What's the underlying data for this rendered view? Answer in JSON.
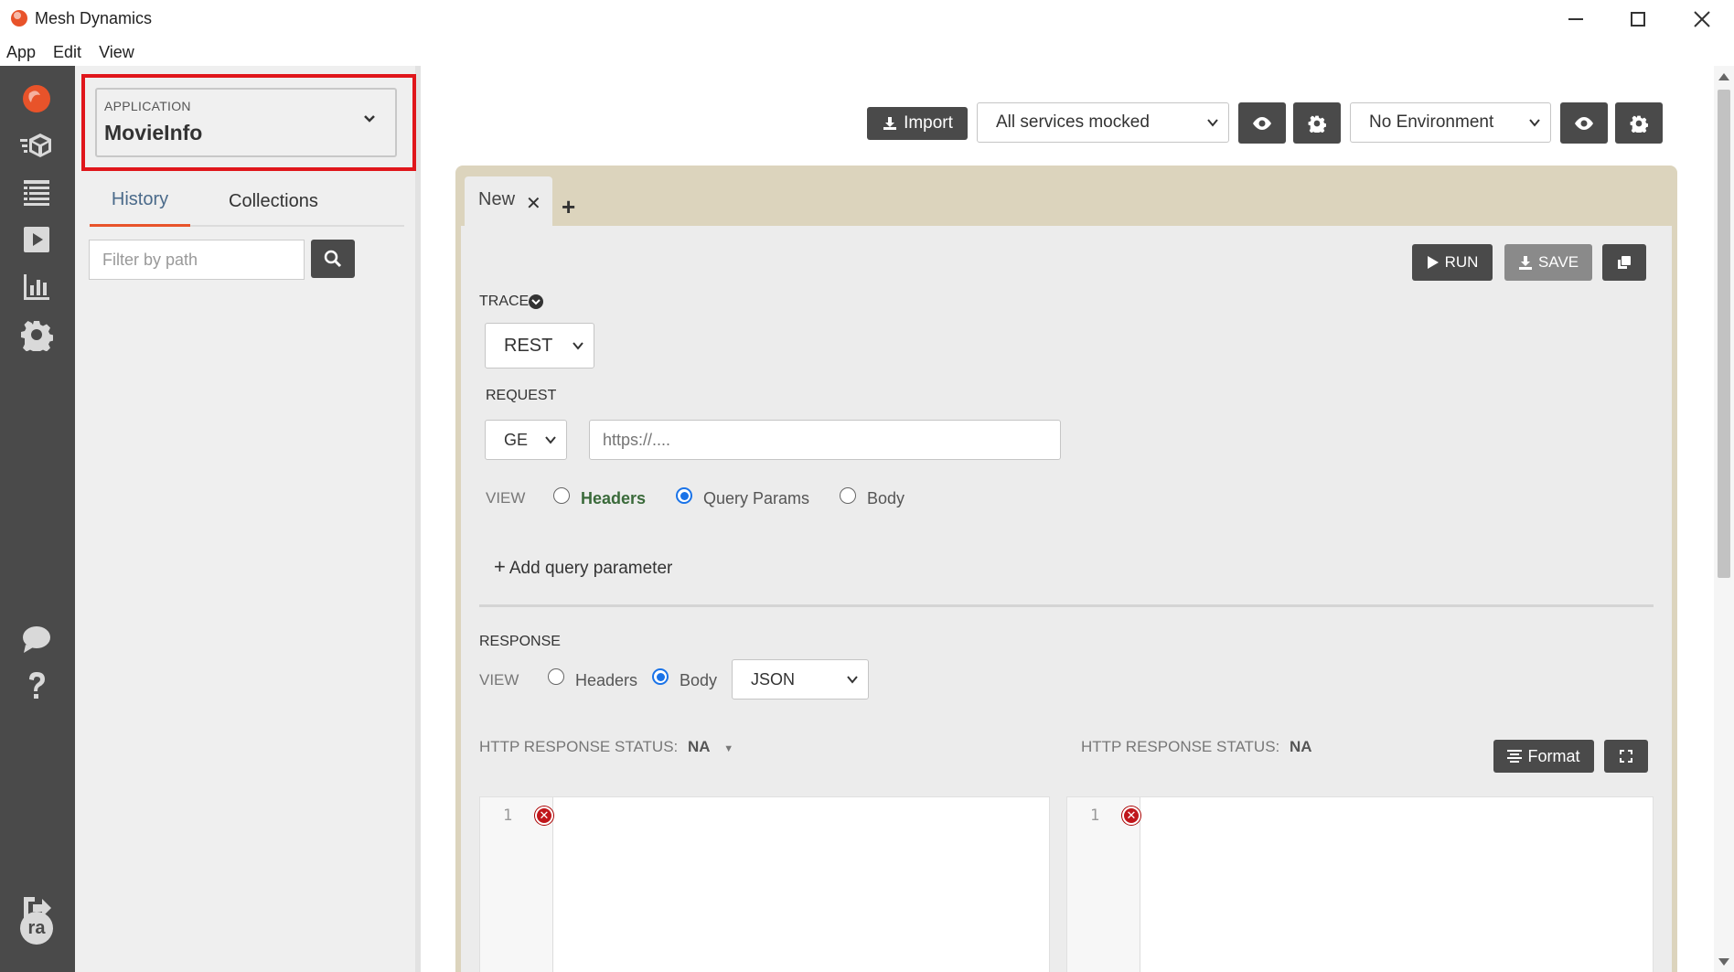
{
  "window": {
    "title": "Mesh Dynamics"
  },
  "menu": {
    "items": [
      "App",
      "Edit",
      "View"
    ]
  },
  "rail": {
    "icons": [
      "logo-icon",
      "test-suite-icon",
      "list-icon",
      "play-icon",
      "chart-icon",
      "gear-icon",
      "chat-icon",
      "help-icon",
      "logout-icon"
    ],
    "avatar_initials": "ra"
  },
  "sidebar": {
    "application_label": "APPLICATION",
    "application_value": "MovieInfo",
    "tabs": [
      "History",
      "Collections"
    ],
    "filter_placeholder": "Filter by path"
  },
  "toolbar": {
    "import_label": "Import",
    "service_select": "All services mocked",
    "environment_select": "No Environment"
  },
  "request_tab": {
    "label": "New"
  },
  "actions": {
    "run_label": "RUN",
    "save_label": "SAVE"
  },
  "trace": {
    "label": "TRACE",
    "type": "REST"
  },
  "request": {
    "label": "REQUEST",
    "method": "GE",
    "url_placeholder": "https://....",
    "view_label": "VIEW",
    "views": [
      "Headers",
      "Query Params",
      "Body"
    ],
    "selected_view": "Query Params",
    "add_param": "Add query parameter"
  },
  "response": {
    "label": "RESPONSE",
    "view_label": "VIEW",
    "views": [
      "Headers",
      "Body"
    ],
    "selected_view": "Body",
    "format_select": "JSON",
    "status_label": "HTTP RESPONSE STATUS:",
    "status_left": "NA",
    "status_right": "NA",
    "format_button": "Format",
    "line_number": "1"
  },
  "colors": {
    "rail": "#4a4a4a",
    "accent": "#e8532a",
    "highlight": "#e0161b",
    "card": "#dcd4bd"
  }
}
